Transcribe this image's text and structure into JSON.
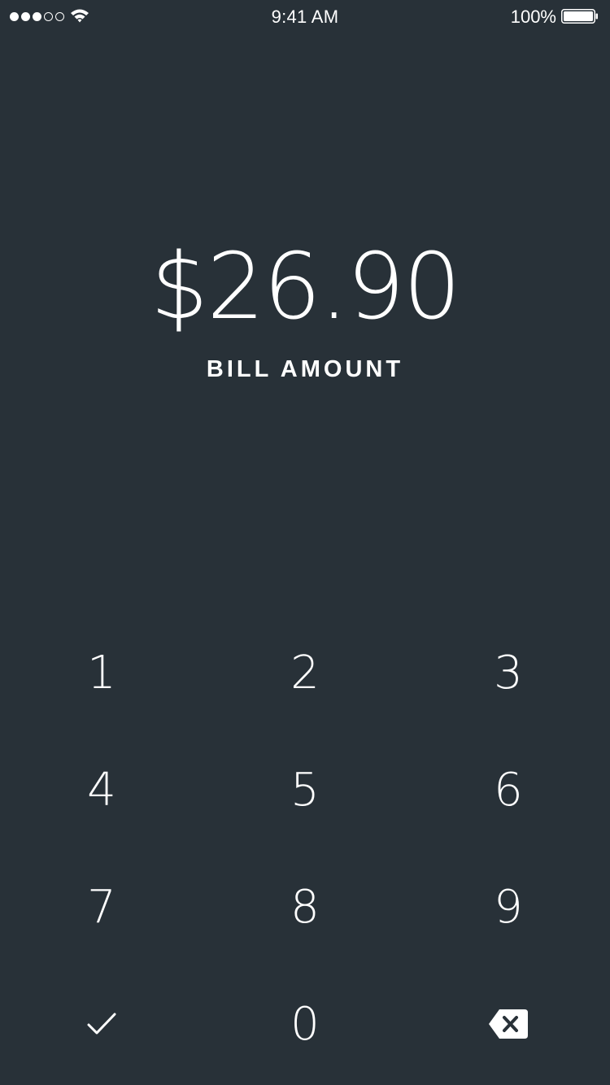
{
  "status_bar": {
    "signal_dots_filled": 3,
    "signal_dots_total": 5,
    "wifi_icon": "wifi-icon",
    "time": "9:41 AM",
    "battery_percent": "100%",
    "battery_level": 1.0
  },
  "bill": {
    "amount": "$26.90",
    "label": "BILL AMOUNT"
  },
  "keypad": {
    "rows": [
      [
        {
          "label": "1"
        },
        {
          "label": "2"
        },
        {
          "label": "3"
        }
      ],
      [
        {
          "label": "4"
        },
        {
          "label": "5"
        },
        {
          "label": "6"
        }
      ],
      [
        {
          "label": "7"
        },
        {
          "label": "8"
        },
        {
          "label": "9"
        }
      ],
      [
        {
          "icon": "checkmark-icon"
        },
        {
          "label": "0"
        },
        {
          "icon": "backspace-icon"
        }
      ]
    ]
  },
  "colors": {
    "background": "#283138",
    "foreground": "#ffffff"
  }
}
